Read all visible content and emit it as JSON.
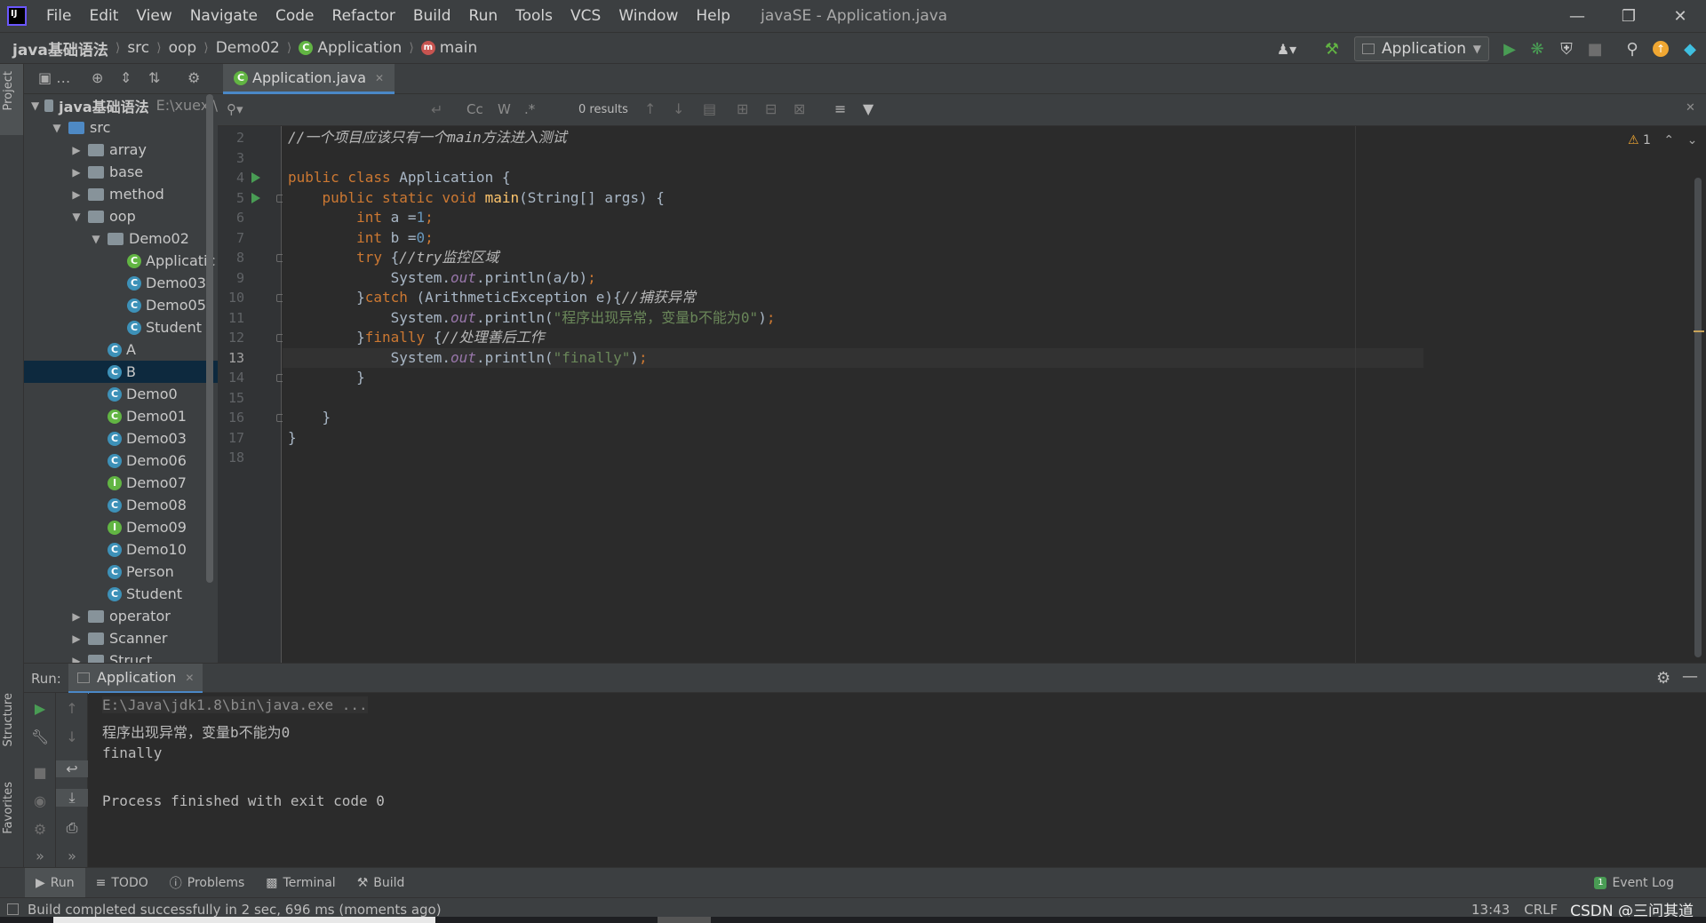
{
  "menubar": {
    "items": [
      "File",
      "Edit",
      "View",
      "Navigate",
      "Code",
      "Refactor",
      "Build",
      "Run",
      "Tools",
      "VCS",
      "Window",
      "Help"
    ],
    "window_title": "javaSE - Application.java"
  },
  "navbar": {
    "breadcrumbs": [
      "java基础语法",
      "src",
      "oop",
      "Demo02",
      "Application",
      "main"
    ],
    "run_config": "Application"
  },
  "project": {
    "side_tab": "Project",
    "root_name": "java基础语法",
    "root_path": "E:\\xuexi\\",
    "tree": [
      {
        "label": "src",
        "kind": "folder-blue",
        "depth": 1,
        "expanded": true
      },
      {
        "label": "array",
        "kind": "folder",
        "depth": 2,
        "expanded": false
      },
      {
        "label": "base",
        "kind": "folder",
        "depth": 2,
        "expanded": false
      },
      {
        "label": "method",
        "kind": "folder",
        "depth": 2,
        "expanded": false
      },
      {
        "label": "oop",
        "kind": "folder",
        "depth": 2,
        "expanded": true
      },
      {
        "label": "Demo02",
        "kind": "folder",
        "depth": 3,
        "expanded": true
      },
      {
        "label": "Applicatic",
        "kind": "class-run",
        "depth": 4
      },
      {
        "label": "Demo03",
        "kind": "class",
        "depth": 4
      },
      {
        "label": "Demo05",
        "kind": "class",
        "depth": 4
      },
      {
        "label": "Student",
        "kind": "class",
        "depth": 4
      },
      {
        "label": "A",
        "kind": "class",
        "depth": 3
      },
      {
        "label": "B",
        "kind": "class",
        "depth": 3,
        "selected": true
      },
      {
        "label": "Demo0",
        "kind": "class",
        "depth": 3
      },
      {
        "label": "Demo01",
        "kind": "class-run",
        "depth": 3
      },
      {
        "label": "Demo03",
        "kind": "class",
        "depth": 3
      },
      {
        "label": "Demo06",
        "kind": "class",
        "depth": 3
      },
      {
        "label": "Demo07",
        "kind": "interface",
        "depth": 3
      },
      {
        "label": "Demo08",
        "kind": "class",
        "depth": 3
      },
      {
        "label": "Demo09",
        "kind": "interface",
        "depth": 3
      },
      {
        "label": "Demo10",
        "kind": "class",
        "depth": 3
      },
      {
        "label": "Person",
        "kind": "class",
        "depth": 3
      },
      {
        "label": "Student",
        "kind": "class",
        "depth": 3
      },
      {
        "label": "operator",
        "kind": "folder",
        "depth": 2,
        "expanded": false
      },
      {
        "label": "Scanner",
        "kind": "folder",
        "depth": 2,
        "expanded": false
      },
      {
        "label": "Struct",
        "kind": "folder",
        "depth": 2,
        "expanded": false
      }
    ]
  },
  "editor": {
    "tab_label": "Application.java",
    "find_results": "0 results",
    "find_opts": [
      "Cc",
      "W",
      ".*"
    ],
    "warning_count": "1",
    "current_line": 13,
    "lines": [
      {
        "n": "2",
        "parts": [
          {
            "t": "//一个项目应该只有一个main方法进入测试",
            "c": "cm"
          }
        ]
      },
      {
        "n": "3",
        "parts": []
      },
      {
        "n": "4",
        "run": true,
        "parts": [
          {
            "t": "public class ",
            "c": "kw"
          },
          {
            "t": "Application {",
            "c": ""
          }
        ]
      },
      {
        "n": "5",
        "run": true,
        "fold": true,
        "parts": [
          {
            "t": "    public static void ",
            "c": "kw"
          },
          {
            "t": "main",
            "c": "fn"
          },
          {
            "t": "(String[] args) {",
            "c": ""
          }
        ]
      },
      {
        "n": "6",
        "parts": [
          {
            "t": "        int ",
            "c": "kw"
          },
          {
            "t": "a =",
            "c": ""
          },
          {
            "t": "1",
            "c": "nm"
          },
          {
            "t": ";",
            "c": "kw"
          }
        ]
      },
      {
        "n": "7",
        "parts": [
          {
            "t": "        int ",
            "c": "kw"
          },
          {
            "t": "b =",
            "c": ""
          },
          {
            "t": "0",
            "c": "nm"
          },
          {
            "t": ";",
            "c": "kw"
          }
        ]
      },
      {
        "n": "8",
        "fold": true,
        "parts": [
          {
            "t": "        try ",
            "c": "kw"
          },
          {
            "t": "{",
            "c": ""
          },
          {
            "t": "//try监控区域",
            "c": "cm"
          }
        ]
      },
      {
        "n": "9",
        "parts": [
          {
            "t": "            System.",
            "c": ""
          },
          {
            "t": "out",
            "c": "fld"
          },
          {
            "t": ".println(a/b)",
            "c": ""
          },
          {
            "t": ";",
            "c": "kw"
          }
        ]
      },
      {
        "n": "10",
        "fold": true,
        "parts": [
          {
            "t": "        }",
            "c": ""
          },
          {
            "t": "catch ",
            "c": "kw"
          },
          {
            "t": "(ArithmeticException e){",
            "c": ""
          },
          {
            "t": "//捕获异常",
            "c": "cm"
          }
        ]
      },
      {
        "n": "11",
        "parts": [
          {
            "t": "            System.",
            "c": ""
          },
          {
            "t": "out",
            "c": "fld"
          },
          {
            "t": ".println(",
            "c": ""
          },
          {
            "t": "\"程序出现异常，变量b不能为0\"",
            "c": "st"
          },
          {
            "t": ")",
            "c": ""
          },
          {
            "t": ";",
            "c": "kw"
          }
        ]
      },
      {
        "n": "12",
        "fold": true,
        "parts": [
          {
            "t": "        }",
            "c": ""
          },
          {
            "t": "finally ",
            "c": "kw"
          },
          {
            "t": "{",
            "c": ""
          },
          {
            "t": "//处理善后工作",
            "c": "cm"
          }
        ]
      },
      {
        "n": "13",
        "parts": [
          {
            "t": "            System.",
            "c": ""
          },
          {
            "t": "out",
            "c": "fld"
          },
          {
            "t": ".println(",
            "c": ""
          },
          {
            "t": "\"finally\"",
            "c": "st"
          },
          {
            "t": ")",
            "c": ""
          },
          {
            "t": ";",
            "c": "kw"
          }
        ]
      },
      {
        "n": "14",
        "fold": true,
        "parts": [
          {
            "t": "        }",
            "c": ""
          }
        ]
      },
      {
        "n": "15",
        "parts": []
      },
      {
        "n": "16",
        "fold": true,
        "parts": [
          {
            "t": "    }",
            "c": ""
          }
        ]
      },
      {
        "n": "17",
        "parts": [
          {
            "t": "}",
            "c": ""
          }
        ]
      },
      {
        "n": "18",
        "parts": []
      }
    ]
  },
  "run_panel": {
    "title": "Run:",
    "tab_label": "Application",
    "console": [
      "E:\\Java\\jdk1.8\\bin\\java.exe ...",
      "程序出现异常，变量b不能为0",
      "finally",
      "",
      "Process finished with exit code 0"
    ]
  },
  "side_tabs_bottom": [
    "Structure",
    "Favorites"
  ],
  "tool_tabs": [
    "Run",
    "TODO",
    "Problems",
    "Terminal",
    "Build"
  ],
  "event_log": "Event Log",
  "event_log_count": "1",
  "status": {
    "message": "Build completed successfully in 2 sec, 696 ms (moments ago)",
    "position": "13:43",
    "line_sep": "CRLF",
    "watermark": "CSDN @三问其道"
  },
  "colors": {
    "accent": "#4a88c7",
    "keyword": "#cc7832",
    "string": "#6a8759",
    "number": "#6897bb",
    "run_green": "#499c54"
  }
}
